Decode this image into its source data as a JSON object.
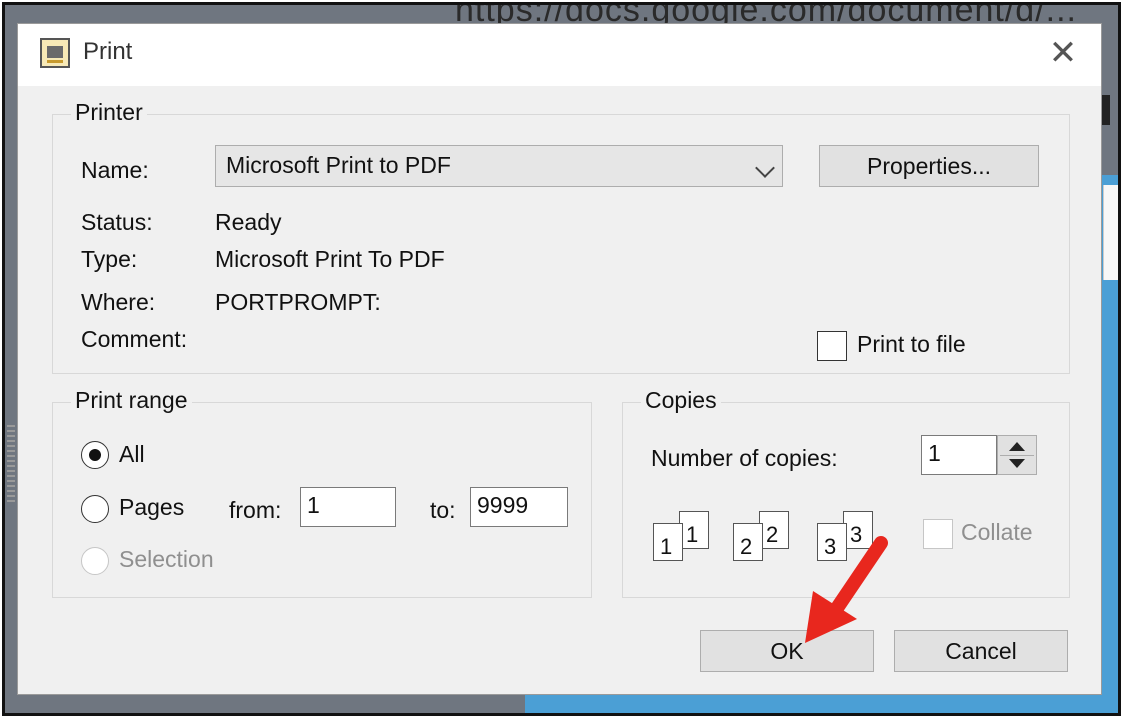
{
  "background": {
    "url_fragment": "https://docs.google.com/document/d/..."
  },
  "dialog": {
    "title": "Print",
    "printer": {
      "legend": "Printer",
      "name_label": "Name:",
      "name_value": "Microsoft Print to PDF",
      "properties_button": "Properties...",
      "status_label": "Status:",
      "status_value": "Ready",
      "type_label": "Type:",
      "type_value": "Microsoft Print To PDF",
      "where_label": "Where:",
      "where_value": "PORTPROMPT:",
      "comment_label": "Comment:",
      "print_to_file_label": "Print to file",
      "print_to_file_checked": false
    },
    "print_range": {
      "legend": "Print range",
      "all_label": "All",
      "pages_label": "Pages",
      "from_label": "from:",
      "from_value": "1",
      "to_label": "to:",
      "to_value": "9999",
      "selection_label": "Selection",
      "selected": "All"
    },
    "copies": {
      "legend": "Copies",
      "number_label": "Number of copies:",
      "number_value": "1",
      "collate_label": "Collate",
      "collate_checked": false,
      "collate_icons": [
        {
          "front": "1",
          "back": "1"
        },
        {
          "front": "2",
          "back": "2"
        },
        {
          "front": "3",
          "back": "3"
        }
      ]
    },
    "ok_button": "OK",
    "cancel_button": "Cancel"
  },
  "colors": {
    "annotation_arrow": "#e8271e",
    "page_blue": "#4b9fd5"
  }
}
